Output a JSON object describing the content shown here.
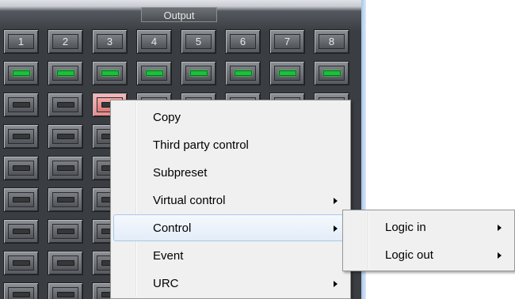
{
  "panel": {
    "output_label": "Output",
    "columns": [
      "1",
      "2",
      "3",
      "4",
      "5",
      "6",
      "7",
      "8"
    ]
  },
  "context_menu": {
    "items": [
      {
        "label": "Copy",
        "has_submenu": false,
        "highlighted": false
      },
      {
        "label": "Third party control",
        "has_submenu": false,
        "highlighted": false
      },
      {
        "label": "Subpreset",
        "has_submenu": false,
        "highlighted": false
      },
      {
        "label": "Virtual control",
        "has_submenu": true,
        "highlighted": false
      },
      {
        "label": "Control",
        "has_submenu": true,
        "highlighted": true
      },
      {
        "label": "Event",
        "has_submenu": false,
        "highlighted": false
      },
      {
        "label": "URC",
        "has_submenu": true,
        "highlighted": false
      }
    ]
  },
  "submenu": {
    "items": [
      {
        "label": "Logic in",
        "has_submenu": true
      },
      {
        "label": "Logic out",
        "has_submenu": true
      }
    ]
  },
  "colors": {
    "led_on": "#19c23a",
    "selected_cell": "#f3a8a8",
    "menu_highlight": "#e3ecf8"
  }
}
